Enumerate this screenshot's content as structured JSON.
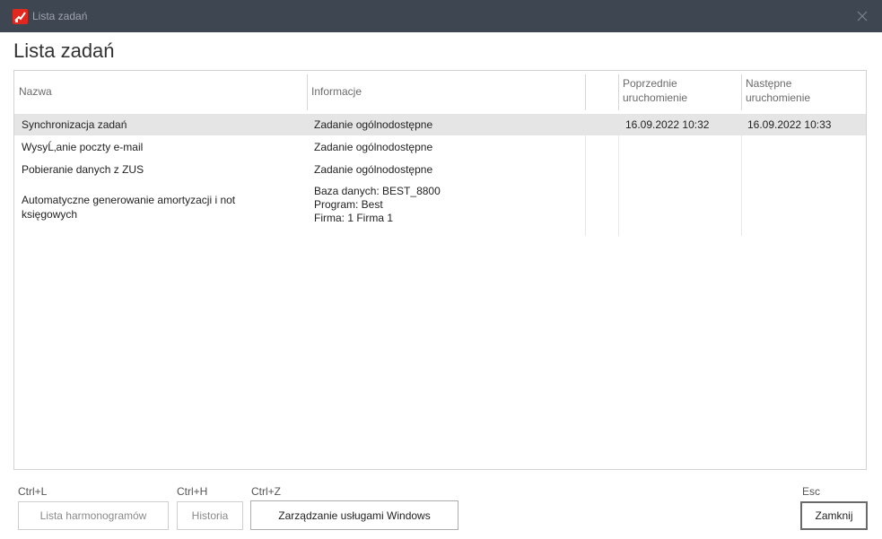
{
  "window": {
    "title": "Lista zadań"
  },
  "page": {
    "title": "Lista zadań"
  },
  "table": {
    "headers": {
      "name": "Nazwa",
      "info": "Informacje",
      "prev_line1": "Poprzednie",
      "prev_line2": "uruchomienie",
      "next_line1": "Następne",
      "next_line2": "uruchomienie"
    },
    "rows": [
      {
        "name": "Synchronizacja zadań",
        "info": "Zadanie ogólnodostępne",
        "prev": "16.09.2022 10:32",
        "next": "16.09.2022 10:33"
      },
      {
        "name": "WysyĹ‚anie poczty e-mail",
        "info": "Zadanie ogólnodostępne",
        "prev": "",
        "next": ""
      },
      {
        "name": "Pobieranie danych z ZUS",
        "info": "Zadanie ogólnodostępne",
        "prev": "",
        "next": ""
      },
      {
        "name_line1": "Automatyczne generowanie amortyzacji i not",
        "name_line2": "księgowych",
        "info_line1": "Baza danych: BEST_8800",
        "info_line2": "Program: Best",
        "info_line3": "Firma: 1 Firma 1",
        "prev": "",
        "next": ""
      }
    ]
  },
  "footer": {
    "schedules": {
      "shortcut": "Ctrl+L",
      "label": "Lista harmonogramów"
    },
    "history": {
      "shortcut": "Ctrl+H",
      "label": "Historia"
    },
    "services": {
      "shortcut": "Ctrl+Z",
      "label": "Zarządzanie usługami Windows"
    },
    "close": {
      "shortcut": "Esc",
      "label": "Zamknij"
    }
  },
  "colors": {
    "titlebar": "#3e4652",
    "selected_row": "#e5e5e5",
    "accent_icon": "#e0281e"
  }
}
